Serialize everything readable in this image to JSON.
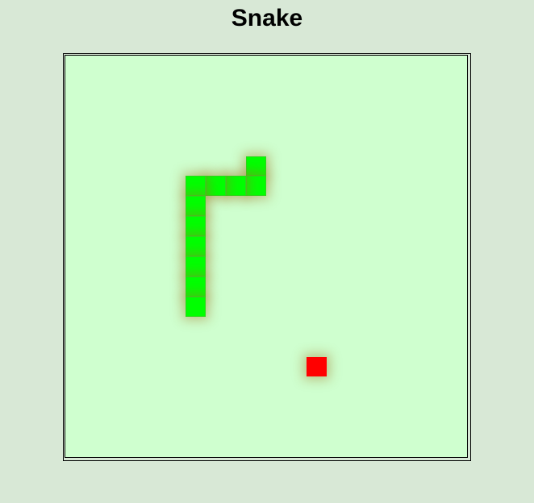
{
  "title": "Snake",
  "game": {
    "grid": {
      "cols": 20,
      "rows": 20
    },
    "colors": {
      "background": "#d8e8d6",
      "board": "#cfffcf",
      "snake": "#00ff00",
      "food": "#ff0000"
    },
    "snake": [
      [
        9,
        5
      ],
      [
        9,
        6
      ],
      [
        8,
        6
      ],
      [
        7,
        6
      ],
      [
        6,
        6
      ],
      [
        6,
        7
      ],
      [
        6,
        8
      ],
      [
        6,
        9
      ],
      [
        6,
        10
      ],
      [
        6,
        11
      ],
      [
        6,
        12
      ]
    ],
    "food": [
      12,
      15
    ]
  }
}
